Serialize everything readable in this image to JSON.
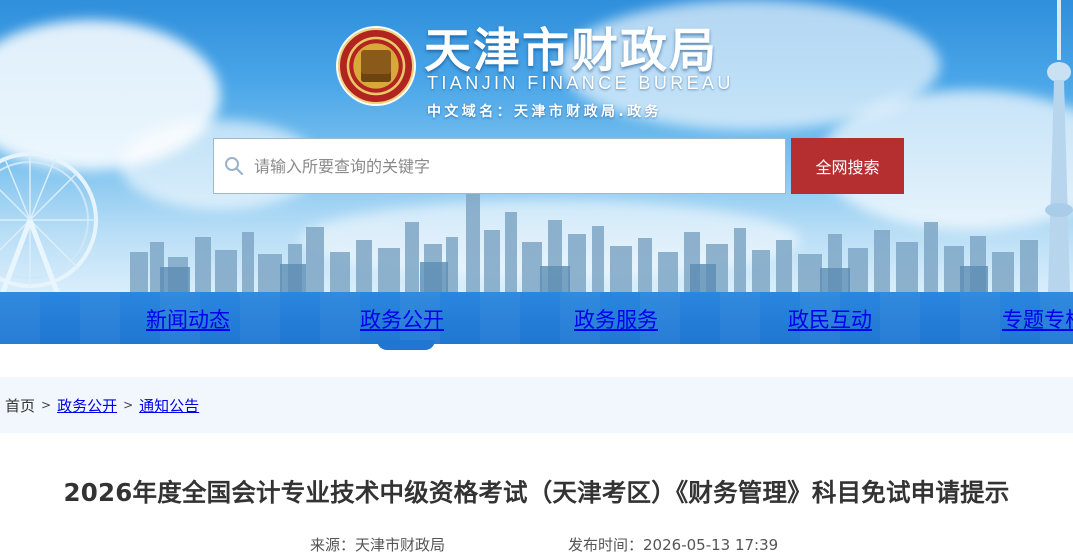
{
  "header": {
    "title_cn": "天津市财政局",
    "title_en": "TIANJIN FINANCE BUREAU",
    "domain_text": "中文域名：天津市财政局.政务"
  },
  "search": {
    "placeholder": "请输入所要查询的关键字",
    "value": "",
    "button_label": "全网搜索",
    "icon": "search-icon"
  },
  "nav": {
    "items": [
      {
        "label": "新闻动态"
      },
      {
        "label": "政务公开"
      },
      {
        "label": "政务服务"
      },
      {
        "label": "政民互动"
      },
      {
        "label": "专题专栏"
      }
    ],
    "active_index": 1
  },
  "breadcrumb": {
    "home": "首页",
    "items": [
      "政务公开",
      "通知公告"
    ],
    "separator": ">"
  },
  "article": {
    "title": "2026年度全国会计专业技术中级资格考试（天津考区）《财务管理》科目免试申请提示",
    "source_label": "来源：",
    "source_value": "天津市财政局",
    "date_label": "发布时间：",
    "date_value": "2026-05-13 17:39"
  },
  "colors": {
    "nav_bg": "#1f77d2",
    "search_button": "#b52f31",
    "breadcrumb_bg": "#f1f7fc",
    "link": "#0000ee"
  }
}
